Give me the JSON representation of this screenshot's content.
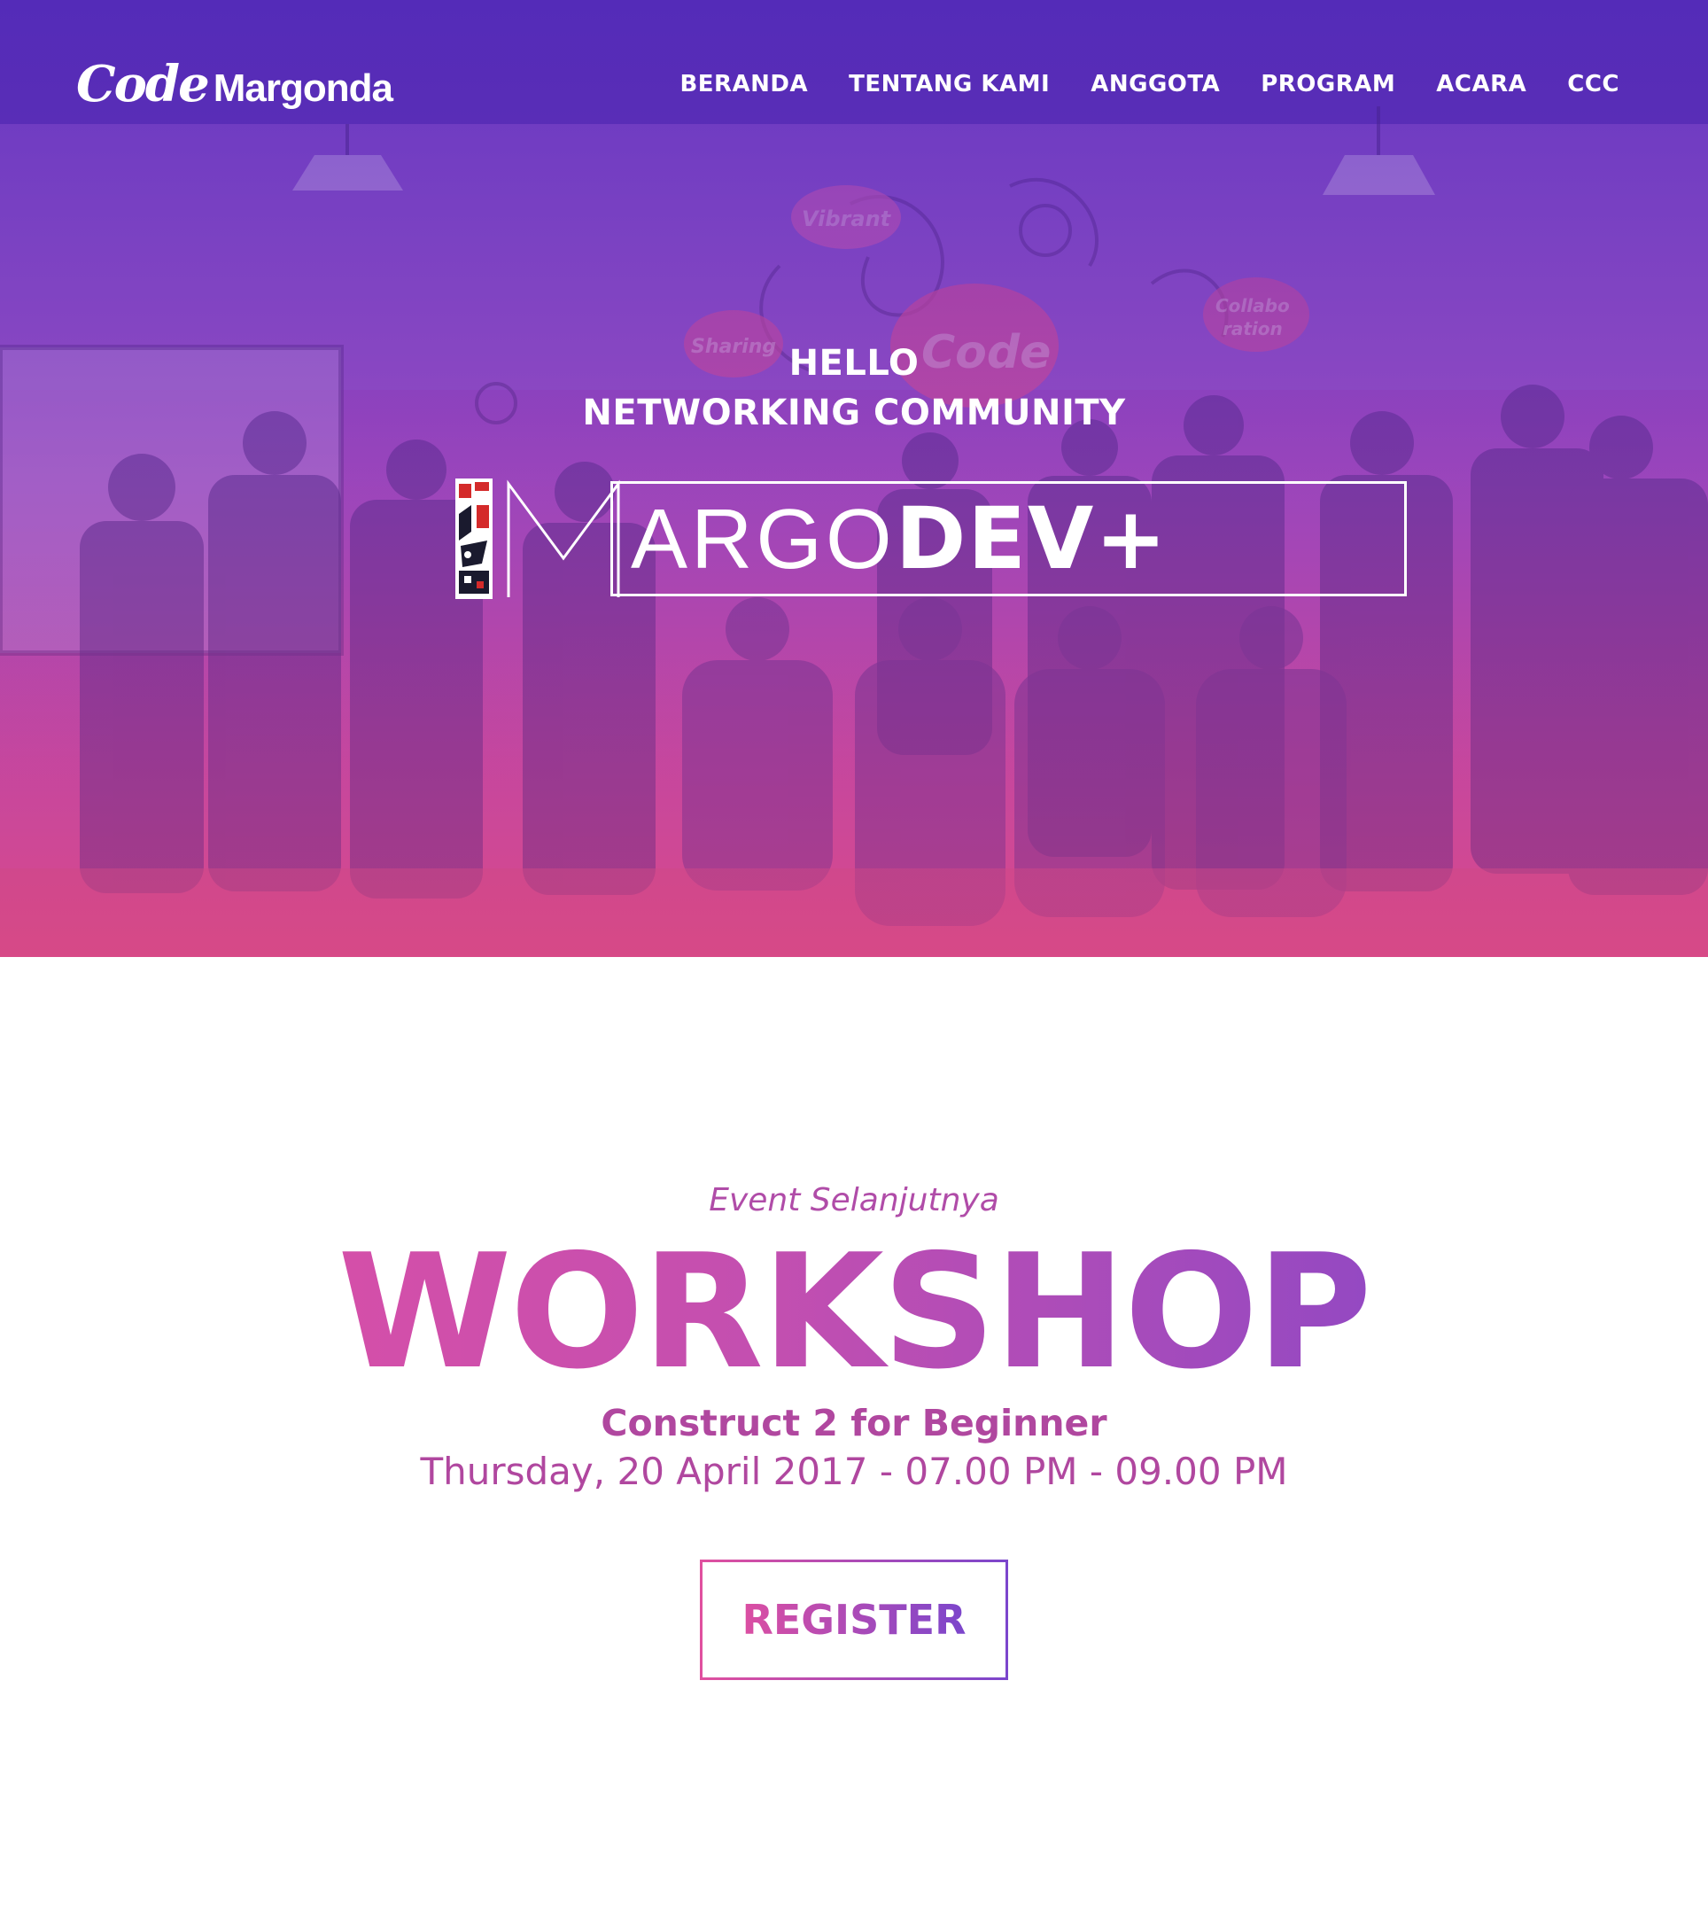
{
  "navbar": {
    "brand_code": "Code",
    "brand_name": "Margonda",
    "items": [
      {
        "label": "BERANDA"
      },
      {
        "label": "TENTANG KAMI"
      },
      {
        "label": "ANGGOTA"
      },
      {
        "label": "PROGRAM"
      },
      {
        "label": "ACARA"
      },
      {
        "label": "CCC"
      }
    ]
  },
  "hero": {
    "greeting_line1": "HELLO",
    "greeting_line2": "NETWORKING COMMUNITY",
    "logo_light": "ARGO",
    "logo_bold": "DEV+",
    "photo_wall_labels": [
      "Vibrant",
      "Sharing",
      "Collabo ration",
      "Code"
    ]
  },
  "event": {
    "kicker": "Event Selanjutnya",
    "title": "WORKSHOP",
    "subtitle": "Construct 2 for Beginner",
    "datetime": "Thursday, 20 April 2017 - 07.00 PM - 09.00 PM",
    "register_label": "REGISTER"
  },
  "colors": {
    "nav_purple": "#5a2fc0",
    "hero_pink": "#dc4d8a",
    "title_gradient_start": "#e24fa3",
    "title_gradient_end": "#7a45cc",
    "event_text": "#b0479f"
  }
}
